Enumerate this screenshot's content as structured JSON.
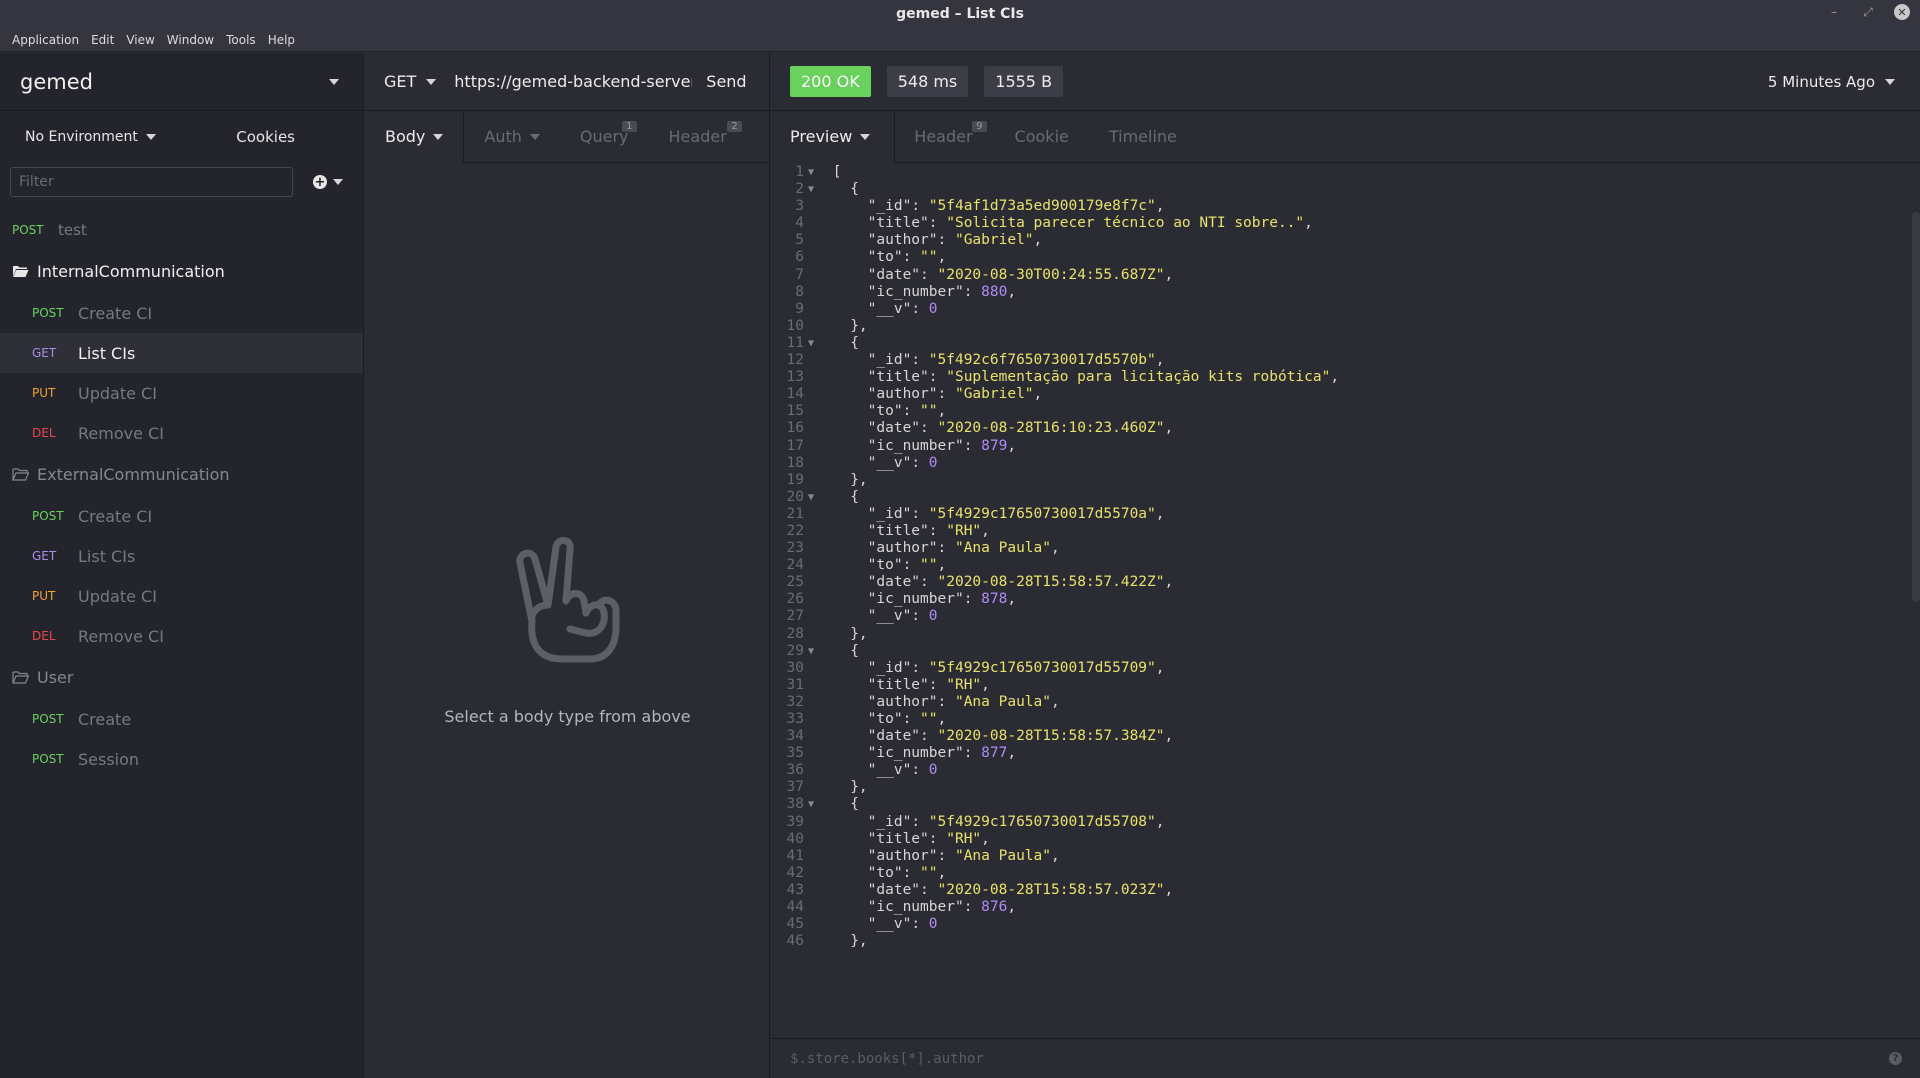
{
  "window": {
    "title": "gemed – List CIs"
  },
  "menu": [
    "Application",
    "Edit",
    "View",
    "Window",
    "Tools",
    "Help"
  ],
  "sidebar": {
    "workspace": "gemed",
    "environment": "No Environment",
    "cookies": "Cookies",
    "filter_placeholder": "Filter",
    "root_request": {
      "method": "POST",
      "name": "test"
    },
    "folders": [
      {
        "name": "InternalCommunication",
        "requests": [
          {
            "method": "POST",
            "name": "Create CI"
          },
          {
            "method": "GET",
            "name": "List CIs"
          },
          {
            "method": "PUT",
            "name": "Update CI"
          },
          {
            "method": "DEL",
            "name": "Remove CI"
          }
        ]
      },
      {
        "name": "ExternalCommunication",
        "requests": [
          {
            "method": "POST",
            "name": "Create CI"
          },
          {
            "method": "GET",
            "name": "List CIs"
          },
          {
            "method": "PUT",
            "name": "Update CI"
          },
          {
            "method": "DEL",
            "name": "Remove CI"
          }
        ]
      },
      {
        "name": "User",
        "requests": [
          {
            "method": "POST",
            "name": "Create"
          },
          {
            "method": "POST",
            "name": "Session"
          }
        ]
      }
    ]
  },
  "request": {
    "method": "GET",
    "url": "https://gemed-backend-server.h",
    "send": "Send",
    "tabs": {
      "body": "Body",
      "auth": "Auth",
      "query": "Query",
      "query_count": "1",
      "header": "Header",
      "header_count": "2"
    },
    "empty_message": "Select a body type from above"
  },
  "response": {
    "status": "200 OK",
    "time": "548 ms",
    "size": "1555 B",
    "time_ago": "5 Minutes Ago",
    "tabs": {
      "preview": "Preview",
      "header": "Header",
      "header_count": "9",
      "cookie": "Cookie",
      "timeline": "Timeline"
    },
    "filter_placeholder": "$.store.books[*].author",
    "lines": [
      "[",
      "  {",
      "    \"_id\": \"5f4af1d73a5ed900179e8f7c\",",
      "    \"title\": \"Solicita parecer técnico ao NTI sobre..\",",
      "    \"author\": \"Gabriel\",",
      "    \"to\": \"\",",
      "    \"date\": \"2020-08-30T00:24:55.687Z\",",
      "    \"ic_number\": 880,",
      "    \"__v\": 0",
      "  },",
      "  {",
      "    \"_id\": \"5f492c6f7650730017d5570b\",",
      "    \"title\": \"Suplementação para licitação kits robótica\",",
      "    \"author\": \"Gabriel\",",
      "    \"to\": \"\",",
      "    \"date\": \"2020-08-28T16:10:23.460Z\",",
      "    \"ic_number\": 879,",
      "    \"__v\": 0",
      "  },",
      "  {",
      "    \"_id\": \"5f4929c17650730017d5570a\",",
      "    \"title\": \"RH\",",
      "    \"author\": \"Ana Paula\",",
      "    \"to\": \"\",",
      "    \"date\": \"2020-08-28T15:58:57.422Z\",",
      "    \"ic_number\": 878,",
      "    \"__v\": 0",
      "  },",
      "  {",
      "    \"_id\": \"5f4929c17650730017d55709\",",
      "    \"title\": \"RH\",",
      "    \"author\": \"Ana Paula\",",
      "    \"to\": \"\",",
      "    \"date\": \"2020-08-28T15:58:57.384Z\",",
      "    \"ic_number\": 877,",
      "    \"__v\": 0",
      "  },",
      "  {",
      "    \"_id\": \"5f4929c17650730017d55708\",",
      "    \"title\": \"RH\",",
      "    \"author\": \"Ana Paula\",",
      "    \"to\": \"\",",
      "    \"date\": \"2020-08-28T15:58:57.023Z\",",
      "    \"ic_number\": 876,",
      "    \"__v\": 0",
      "  },"
    ]
  }
}
